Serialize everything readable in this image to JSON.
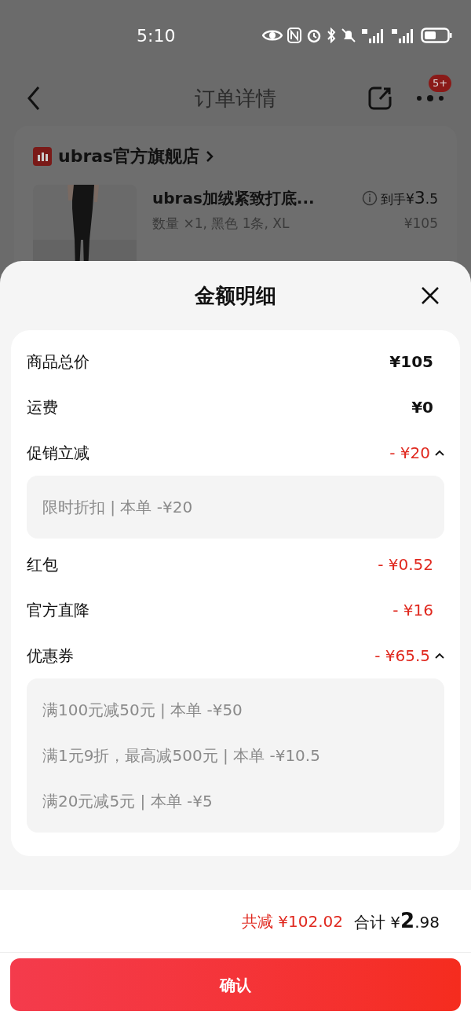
{
  "status_bar": {
    "time": "5:10"
  },
  "nav": {
    "title": "订单详情",
    "badge": "5+"
  },
  "order": {
    "store": "ubras官方旗舰店",
    "product": {
      "name": "ubras加绒紧致打底...",
      "spec": "数量 ×1, 黑色 1条, XL",
      "final_label": "到手",
      "final_price": "¥3.5",
      "price": "¥105"
    }
  },
  "sheet": {
    "title": "金额明细",
    "rows": [
      {
        "label": "商品总价",
        "amount": "¥105",
        "discount": false
      },
      {
        "label": "运费",
        "amount": "¥0",
        "discount": false
      },
      {
        "label": "促销立减",
        "amount": "- ¥20",
        "discount": true,
        "expanded": true,
        "details": [
          "限时折扣 | 本单 -¥20"
        ]
      },
      {
        "label": "红包",
        "amount": "- ¥0.52",
        "discount": true
      },
      {
        "label": "官方直降",
        "amount": "- ¥16",
        "discount": true
      },
      {
        "label": "优惠券",
        "amount": "- ¥65.5",
        "discount": true,
        "expanded": true,
        "details": [
          "满100元减50元 | 本单 -¥50",
          "满1元9折，最高减500元 | 本单 -¥10.5",
          "满20元减5元 | 本单 -¥5"
        ]
      }
    ],
    "saved": "共减 ¥102.02",
    "total_label": "合计",
    "total": "¥2.98",
    "confirm": "确认"
  }
}
